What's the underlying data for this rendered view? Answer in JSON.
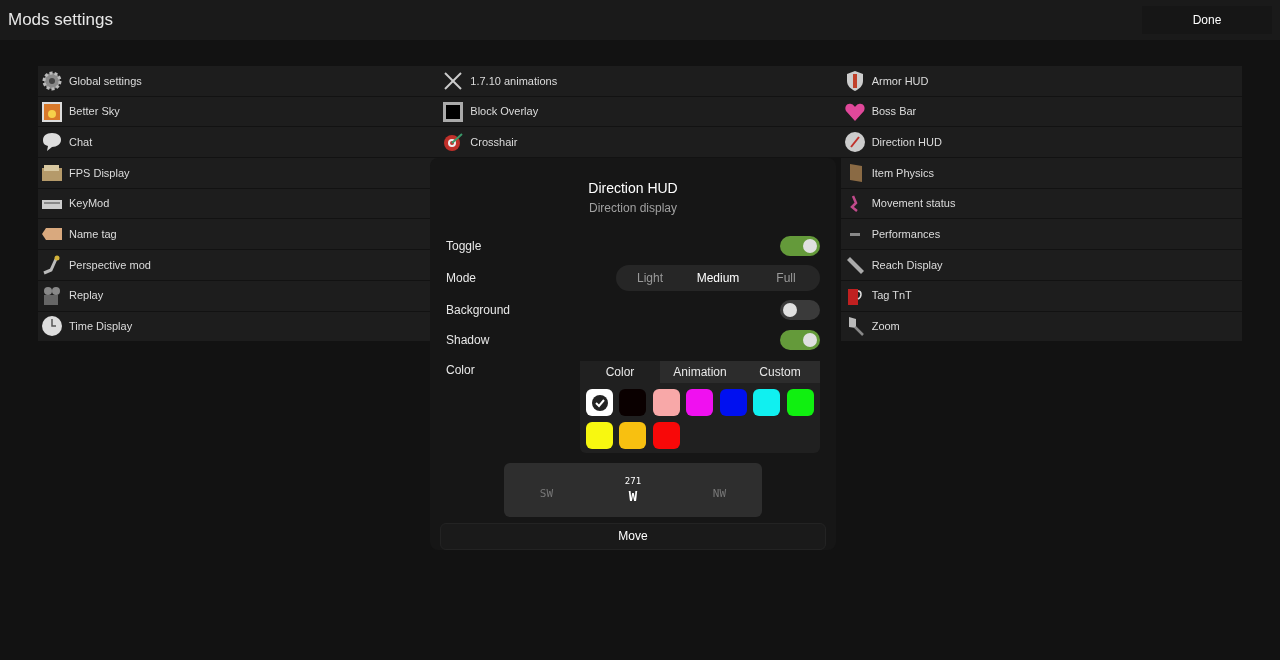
{
  "header": {
    "title": "Mods settings",
    "done_button": "Done"
  },
  "columns": [
    [
      {
        "label": "Global settings"
      },
      {
        "label": "Better Sky"
      },
      {
        "label": "Chat"
      },
      {
        "label": "FPS Display"
      },
      {
        "label": "KeyMod"
      },
      {
        "label": "Name tag"
      },
      {
        "label": "Perspective mod"
      },
      {
        "label": "Replay"
      },
      {
        "label": "Time Display"
      }
    ],
    [
      {
        "label": "1.7.10 animations"
      },
      {
        "label": "Block Overlay"
      },
      {
        "label": "Crosshair"
      }
    ],
    [
      {
        "label": "Armor HUD"
      },
      {
        "label": "Boss Bar"
      },
      {
        "label": "Direction HUD"
      },
      {
        "label": "Item Physics"
      },
      {
        "label": "Movement status"
      },
      {
        "label": "Performances"
      },
      {
        "label": "Reach Display"
      },
      {
        "label": "Tag TnT"
      },
      {
        "label": "Zoom"
      }
    ]
  ],
  "dialog": {
    "title": "Direction HUD",
    "subtitle": "Direction display",
    "settings": [
      {
        "kind": "toggle",
        "label": "Toggle",
        "on": true
      },
      {
        "kind": "segmented",
        "label": "Mode",
        "options": [
          {
            "label": "Light",
            "selected": false
          },
          {
            "label": "Medium",
            "selected": true
          },
          {
            "label": "Full",
            "selected": false
          }
        ]
      },
      {
        "kind": "toggle",
        "label": "Background",
        "on": false
      },
      {
        "kind": "toggle",
        "label": "Shadow",
        "on": true
      },
      {
        "kind": "color",
        "label": "Color",
        "tabs": [
          {
            "label": "Color",
            "selected": true
          },
          {
            "label": "Animation",
            "selected": false
          },
          {
            "label": "Custom",
            "selected": false
          }
        ],
        "swatches": [
          {
            "color": "#ffffff",
            "selected": true
          },
          {
            "color": "#0a0000",
            "selected": false
          },
          {
            "color": "#f8a8a8",
            "selected": false
          },
          {
            "color": "#f010f0",
            "selected": false
          },
          {
            "color": "#0010f0",
            "selected": false
          },
          {
            "color": "#10f0f0",
            "selected": false
          },
          {
            "color": "#10f010",
            "selected": false
          },
          {
            "color": "#f8f810",
            "selected": false
          },
          {
            "color": "#f8c010",
            "selected": false
          },
          {
            "color": "#f80808",
            "selected": false
          }
        ]
      }
    ],
    "preview": {
      "left": "SW",
      "heading": "271",
      "center": "W",
      "right": "NW"
    },
    "move_button": "Move"
  }
}
